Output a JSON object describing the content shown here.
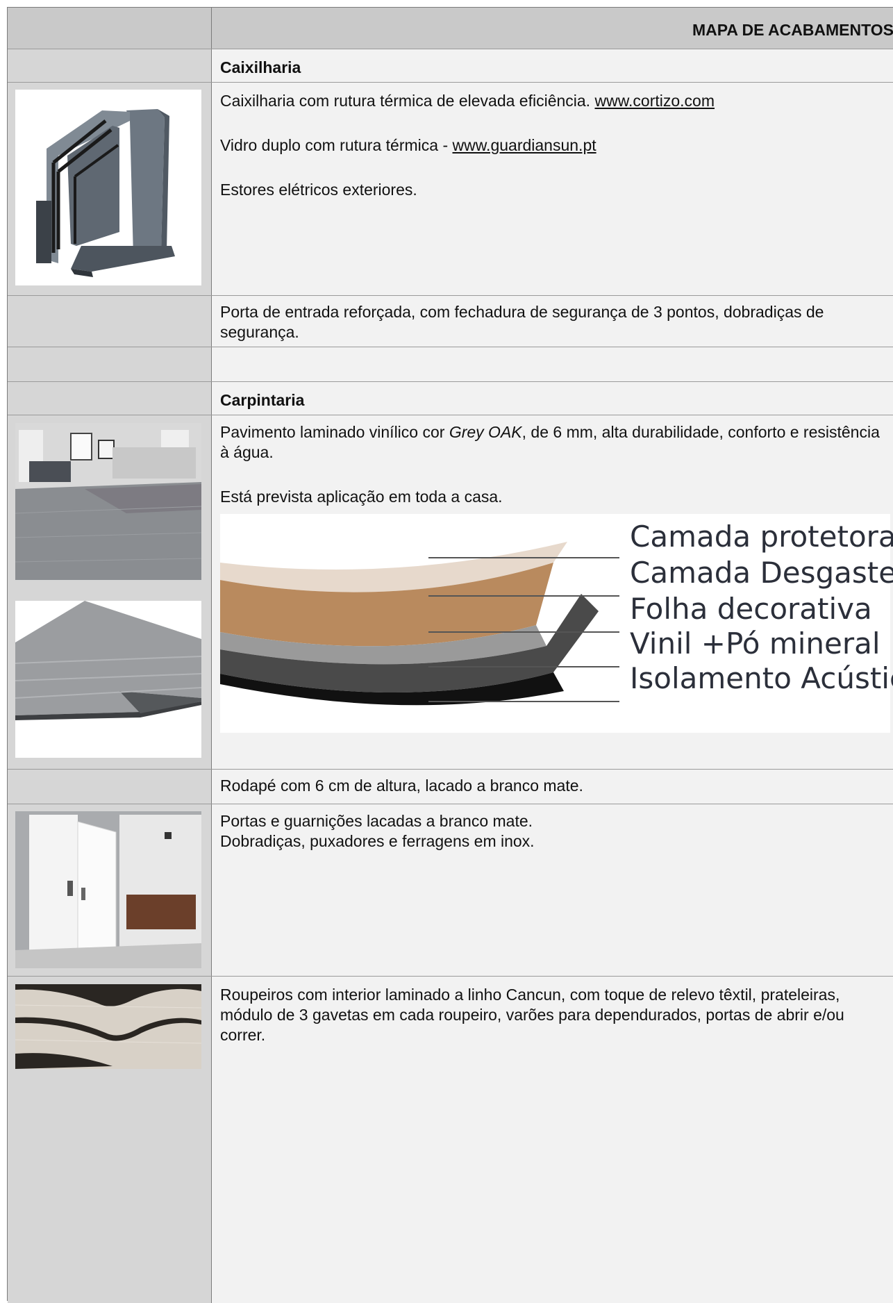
{
  "header": {
    "title": "MAPA DE ACABAMENTOS"
  },
  "caixilharia": {
    "title": "Caixilharia",
    "line1_text": "Caixilharia com rutura térmica de elevada eficiência. ",
    "line1_link": "www.cortizo.com",
    "line2_text": "Vidro duplo com rutura térmica - ",
    "line2_link": "www.guardiansun.pt",
    "line3": "Estores elétricos exteriores.",
    "image_icon": "window-frame-profile-image"
  },
  "porta_entrada": {
    "text": "Porta de entrada reforçada, com fechadura de segurança de 3 pontos, dobradiças de segurança."
  },
  "carpintaria": {
    "title": "Carpintaria",
    "pav_pre": "Pavimento laminado vinílico cor ",
    "pav_italic": "Grey OAK",
    "pav_post": ", de 6 mm, alta durabilidade, conforto e resistência à água.",
    "aplicacao": "Está prevista aplicação em toda a casa.",
    "layers": [
      "Camada protetora",
      "Camada Desgaste",
      "Folha decorativa",
      "Vinil +Pó mineral",
      "Isolamento Acústico"
    ]
  },
  "rodape": {
    "text": "Rodapé com 6 cm de altura, lacado a branco mate."
  },
  "portas": {
    "line1": "Portas e guarnições lacadas a branco mate.",
    "line2": "Dobradiças, puxadores e ferragens em inox."
  },
  "roupeiros": {
    "text": "Roupeiros com interior laminado a linho Cancun, com toque de relevo têxtil, prateleiras, módulo de 3 gavetas em cada roupeiro, varões para dependurados, portas de abrir e/ou correr."
  },
  "colors": {
    "header_bg": "#c9c9c9",
    "left_col_bg": "#d6d6d6",
    "right_col_bg": "#f2f2f2"
  }
}
